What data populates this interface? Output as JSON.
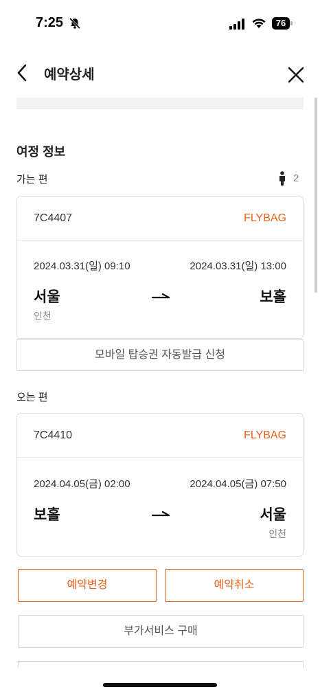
{
  "status_bar": {
    "time": "7:25",
    "battery": "76"
  },
  "header": {
    "title": "예약상세"
  },
  "section": {
    "title": "여정 정보"
  },
  "outbound": {
    "label": "가는 편",
    "passengers": "2",
    "flight_no": "7C4407",
    "badge": "FLYBAG",
    "dep_datetime": "2024.03.31(일) 09:10",
    "arr_datetime": "2024.03.31(일) 13:00",
    "dep_city": "서울",
    "dep_airport": "인천",
    "arr_city": "보홀",
    "arr_airport": ""
  },
  "mobile_pass_button": "모바일 탑승권 자동발급 신청",
  "inbound": {
    "label": "오는 편",
    "flight_no": "7C4410",
    "badge": "FLYBAG",
    "dep_datetime": "2024.04.05(금) 02:00",
    "arr_datetime": "2024.04.05(금) 07:50",
    "dep_city": "보홀",
    "dep_airport": "",
    "arr_city": "서울",
    "arr_airport": "인천"
  },
  "actions": {
    "change": "예약변경",
    "cancel": "예약취소",
    "extra_services": "부가서비스 구매"
  },
  "colors": {
    "accent": "#e8611a",
    "border": "#dddddd"
  }
}
